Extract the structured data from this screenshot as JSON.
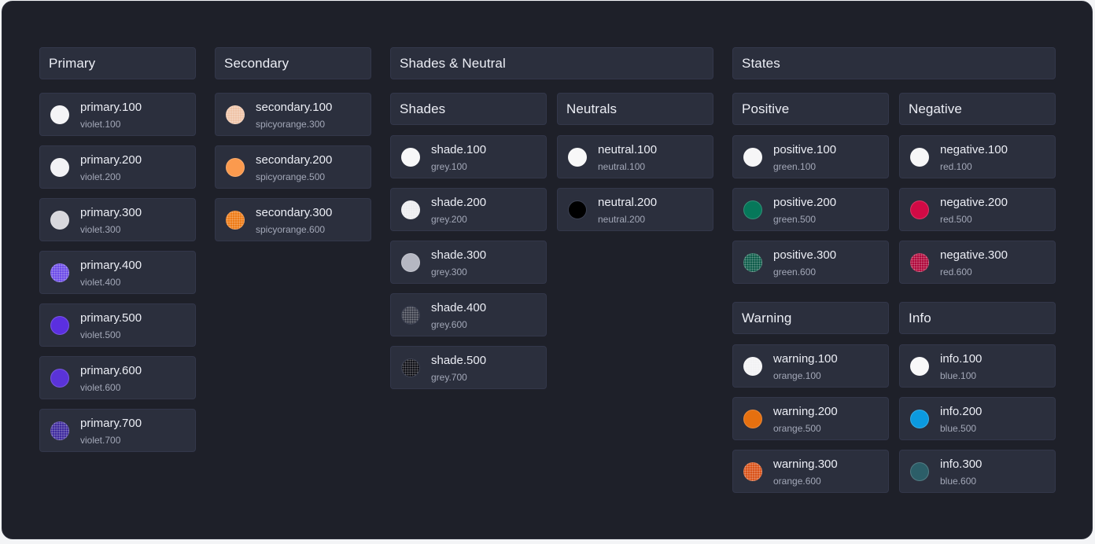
{
  "sections": {
    "primary": "Primary",
    "secondary": "Secondary",
    "shades_neutral": "Shades & Neutral",
    "shades": "Shades",
    "neutrals": "Neutrals",
    "states": "States",
    "positive": "Positive",
    "negative": "Negative",
    "warning": "Warning",
    "info": "Info"
  },
  "primary": [
    {
      "token": "primary.100",
      "alias": "violet.100",
      "color": "#f4f4f6"
    },
    {
      "token": "primary.200",
      "alias": "violet.200",
      "color": "#f2f2f5"
    },
    {
      "token": "primary.300",
      "alias": "violet.300",
      "color": "#d8d8dd"
    },
    {
      "token": "primary.400",
      "alias": "violet.400",
      "color": "#6d4de8"
    },
    {
      "token": "primary.500",
      "alias": "violet.500",
      "color": "#5b2fe0"
    },
    {
      "token": "primary.600",
      "alias": "violet.600",
      "color": "#5a33d8"
    },
    {
      "token": "primary.700",
      "alias": "violet.700",
      "color": "#3f2b9e"
    }
  ],
  "secondary": [
    {
      "token": "secondary.100",
      "alias": "spicyorange.300",
      "color": "#efc4a8"
    },
    {
      "token": "secondary.200",
      "alias": "spicyorange.500",
      "color": "#fb9a4e"
    },
    {
      "token": "secondary.300",
      "alias": "spicyorange.600",
      "color": "#ee7b16"
    }
  ],
  "shades": [
    {
      "token": "shade.100",
      "alias": "grey.100",
      "color": "#f7f7f8"
    },
    {
      "token": "shade.200",
      "alias": "grey.200",
      "color": "#ececef"
    },
    {
      "token": "shade.300",
      "alias": "grey.300",
      "color": "#b5b7c2"
    },
    {
      "token": "shade.400",
      "alias": "grey.600",
      "color": "#3a3d4a"
    },
    {
      "token": "shade.500",
      "alias": "grey.700",
      "color": "#121319"
    }
  ],
  "neutrals": [
    {
      "token": "neutral.100",
      "alias": "neutral.100",
      "color": "#f8f8f8"
    },
    {
      "token": "neutral.200",
      "alias": "neutral.200",
      "color": "#000000"
    }
  ],
  "positive": [
    {
      "token": "positive.100",
      "alias": "green.100",
      "color": "#f6f6f7"
    },
    {
      "token": "positive.200",
      "alias": "green.500",
      "color": "#06785a"
    },
    {
      "token": "positive.300",
      "alias": "green.600",
      "color": "#0f5c4a"
    }
  ],
  "negative": [
    {
      "token": "negative.100",
      "alias": "red.100",
      "color": "#f6f6f7"
    },
    {
      "token": "negative.200",
      "alias": "red.500",
      "color": "#d10a45"
    },
    {
      "token": "negative.300",
      "alias": "red.600",
      "color": "#b00a3c"
    }
  ],
  "warning": [
    {
      "token": "warning.100",
      "alias": "orange.100",
      "color": "#f2f2f4"
    },
    {
      "token": "warning.200",
      "alias": "orange.500",
      "color": "#e6700f"
    },
    {
      "token": "warning.300",
      "alias": "orange.600",
      "color": "#d9531a"
    }
  ],
  "info": [
    {
      "token": "info.100",
      "alias": "blue.100",
      "color": "#f8f8f9"
    },
    {
      "token": "info.200",
      "alias": "blue.500",
      "color": "#0b9ae0"
    },
    {
      "token": "info.300",
      "alias": "blue.600",
      "color": "#2c5e68"
    }
  ]
}
